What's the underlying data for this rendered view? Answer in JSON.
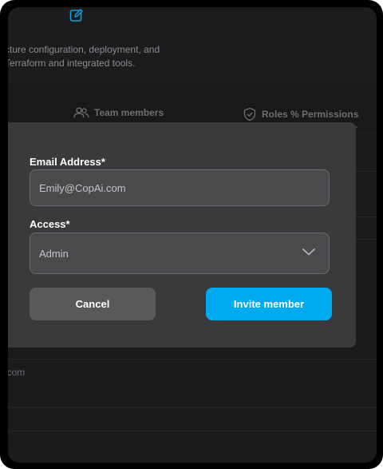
{
  "background": {
    "description_line1": "cture configuration, deployment, and",
    "description_line2": "Terraform and integrated tools.",
    "tabs": [
      {
        "label": "Team members",
        "icon": "users-icon"
      },
      {
        "label": "Roles % Permissions",
        "icon": "shield-check-icon"
      }
    ],
    "partial_email": "y.com"
  },
  "modal": {
    "email_label": "Email Address*",
    "email_value": "Emily@CopAi.com",
    "access_label": "Access*",
    "access_value": "Admin",
    "cancel_label": "Cancel",
    "invite_label": "Invite member"
  },
  "colors": {
    "accent": "#00aaef",
    "modal_bg": "#3a3a3c",
    "page_bg": "#1b1b1d"
  }
}
